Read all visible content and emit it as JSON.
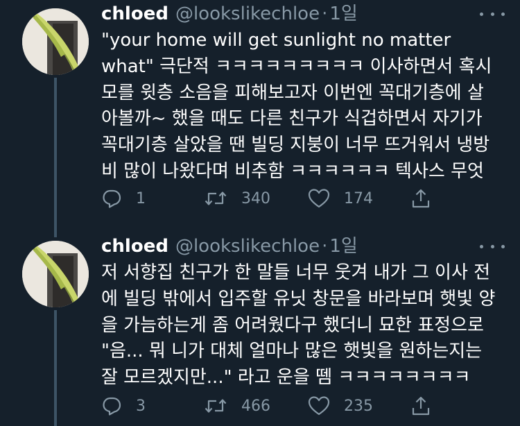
{
  "colors": {
    "background": "#15202b",
    "text": "#ffffff",
    "muted": "#8899a6",
    "thread_line": "#3d5466"
  },
  "tweets": [
    {
      "name": "chloed",
      "handle": "@lookslikechloe",
      "separator": "·",
      "time": "1일",
      "lines": [
        "\"your home will get sunlight no matter",
        "what\" 극단적 ㅋㅋㅋㅋㅋㅋㅋㅋㅋ 이사하면서 혹시",
        "모를 윗층 소음을 피해보고자 이번엔 꼭대기층에 살",
        "아볼까~ 했을 때도 다른 친구가 식겁하면서 자기가",
        "꼭대기층 살았을 땐 빌딩 지붕이 너무 뜨거워서 냉방",
        "비 많이 나왔다며 비추함 ㅋㅋㅋㅋㅋㅋ 텍사스 무엇"
      ],
      "replies": "1",
      "retweets": "340",
      "likes": "174",
      "icons": [
        "reply-icon",
        "retweet-icon",
        "like-icon",
        "share-icon"
      ]
    },
    {
      "name": "chloed",
      "handle": "@lookslikechloe",
      "separator": "·",
      "time": "1일",
      "lines": [
        "저 서향집 친구가 한 말들 너무 웃겨 내가 그 이사 전",
        "에 빌딩 밖에서 입주할 유닛 창문을 바라보며 햇빛 양",
        "을 가늠하는게 좀 어려웠다구 했더니 묘한 표정으로",
        "\"음... 뭐 니가 대체 얼마나 많은 햇빛을 원하는지는",
        "잘 모르겠지만...\" 라고 운을 뗌 ㅋㅋㅋㅋㅋㅋㅋㅋ"
      ],
      "replies": "3",
      "retweets": "466",
      "likes": "235",
      "icons": [
        "reply-icon",
        "retweet-icon",
        "like-icon",
        "share-icon"
      ]
    }
  ]
}
